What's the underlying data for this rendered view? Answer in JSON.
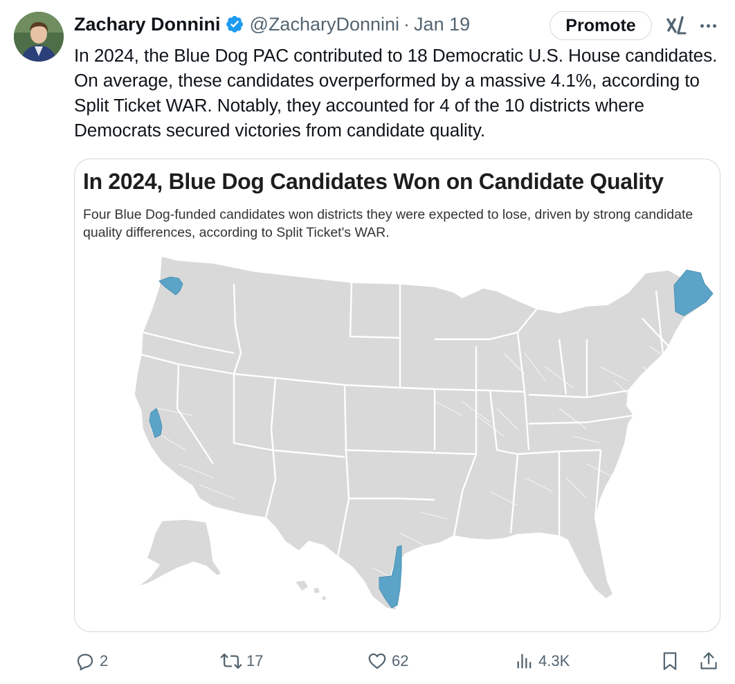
{
  "author": {
    "name": "Zachary Donnini",
    "handle": "@ZacharyDonnini",
    "separator": "·",
    "date": "Jan 19",
    "verified_icon": "verified-badge-icon"
  },
  "header_actions": {
    "promote_label": "Promote",
    "grok_icon": "grok-icon",
    "more_icon": "more-icon"
  },
  "tweet": {
    "text": "In 2024, the Blue Dog PAC contributed to 18 Democratic U.S. House candidates. On average, these candidates overperformed by a massive 4.1%, according to Split Ticket WAR. Notably, they accounted for 4 of the 10 districts where Democrats secured victories from candidate quality."
  },
  "card": {
    "title": "In 2024, Blue Dog Candidates Won on Candidate Quality",
    "subtitle": "Four Blue Dog-funded candidates won districts they were expected to lose, driven by strong candidate quality differences, according to Split Ticket's WAR."
  },
  "map": {
    "base_color": "#d9d9d9",
    "highlight_color": "#5ba4c8",
    "border_color": "#ffffff"
  },
  "actions": {
    "reply_count": "2",
    "repost_count": "17",
    "like_count": "62",
    "views_count": "4.3K",
    "reply_icon": "reply-icon",
    "repost_icon": "repost-icon",
    "like_icon": "heart-icon",
    "views_icon": "views-icon",
    "bookmark_icon": "bookmark-icon",
    "share_icon": "share-icon"
  },
  "colors": {
    "text_secondary": "#536471",
    "verified_blue": "#1d9bf0"
  }
}
